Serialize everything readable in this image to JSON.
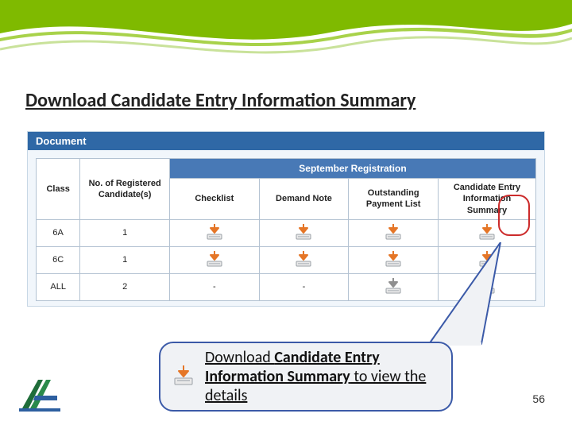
{
  "title": "Download Candidate Entry Information Summary",
  "panel_header": "Document",
  "section_header": "September Registration",
  "columns": {
    "class": "Class",
    "registered": "No. of Registered\nCandidate(s)",
    "checklist": "Checklist",
    "demand": "Demand Note",
    "outstanding": "Outstanding\nPayment List",
    "summary": "Candidate Entry\nInformation Summary"
  },
  "rows": [
    {
      "class": "6A",
      "count": "1",
      "checklist": "dl",
      "demand": "dl",
      "outstanding": "dl",
      "summary": "dl"
    },
    {
      "class": "6C",
      "count": "1",
      "checklist": "dl",
      "demand": "dl",
      "outstanding": "dl",
      "summary": "dl"
    },
    {
      "class": "ALL",
      "count": "2",
      "checklist": "-",
      "demand": "-",
      "outstanding": "dlgrey",
      "summary": "dl"
    }
  ],
  "callout": {
    "prefix": "Download ",
    "bold": "Candidate Entry Information Summary",
    "suffix": " to view the details"
  },
  "page_number": "56",
  "colors": {
    "accent": "#7fba00",
    "panel_blue": "#4879b6",
    "header_blue": "#2f68a6",
    "ring": "#cc2b2b"
  }
}
